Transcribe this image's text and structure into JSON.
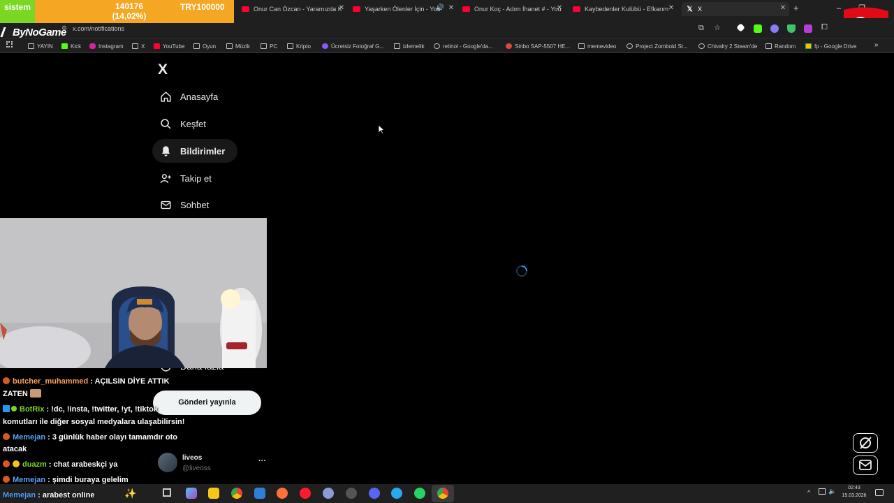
{
  "overlay": {
    "stat_left": "sistem",
    "stat_mid": "140176 (14,02%)",
    "stat_right": "TRY100000",
    "brand": "ByNoGame"
  },
  "browser": {
    "tabs": [
      {
        "title": "Onur Can Özcan - Yaramızda K",
        "icon": "youtube-icon"
      },
      {
        "title": "Yaşarken Ölenler İçin - You",
        "icon": "youtube-icon"
      },
      {
        "title": "Onur Koç - Adım İhanet # - You",
        "icon": "youtube-icon"
      },
      {
        "title": "Kaybedenler Kulübü - Efkarım",
        "icon": "youtube-icon"
      },
      {
        "title": "X",
        "icon": "x-icon"
      }
    ],
    "url": "x.com/notifications",
    "bookmarks": [
      {
        "label": "YAYIN",
        "icon": "folder-icon"
      },
      {
        "label": "Kick",
        "icon": "kick-icon"
      },
      {
        "label": "Instagram",
        "icon": "instagram-icon"
      },
      {
        "label": "X",
        "icon": "x-icon"
      },
      {
        "label": "YouTube",
        "icon": "youtube-icon"
      },
      {
        "label": "Oyun",
        "icon": "folder-icon"
      },
      {
        "label": "Müzik",
        "icon": "folder-icon"
      },
      {
        "label": "PC",
        "icon": "folder-icon"
      },
      {
        "label": "Kripto",
        "icon": "folder-icon"
      },
      {
        "label": "Ücretsiz Fotoğraf G...",
        "icon": "site-icon"
      },
      {
        "label": "izlemelik",
        "icon": "folder-icon"
      },
      {
        "label": "retinol - Google'da...",
        "icon": "google-icon"
      },
      {
        "label": "Sinbo SAP-5507 HE...",
        "icon": "site-icon"
      },
      {
        "label": "memevideo",
        "icon": "folder-icon"
      },
      {
        "label": "Project Zomboid St...",
        "icon": "steam-icon"
      },
      {
        "label": "Chivalry 2 Steam'de",
        "icon": "steam-icon"
      },
      {
        "label": "Random",
        "icon": "folder-icon"
      },
      {
        "label": "fp - Google Drive",
        "icon": "drive-icon"
      }
    ]
  },
  "sidebar": {
    "logo": "X",
    "items": [
      {
        "label": "Anasayfa",
        "icon": "home-icon"
      },
      {
        "label": "Keşfet",
        "icon": "search-icon"
      },
      {
        "label": "Bildirimler",
        "icon": "bell-icon",
        "active": true
      },
      {
        "label": "Takip et",
        "icon": "person-add-icon"
      },
      {
        "label": "Sohbet",
        "icon": "mail-icon"
      },
      {
        "label": "Daha fazla",
        "icon": "more-icon"
      }
    ],
    "post_button": "Gönderi yayınla",
    "account": {
      "name": "liveos",
      "handle": "@liveoss",
      "more": "···"
    }
  },
  "chat": [
    {
      "user": "butcher_muhammed",
      "color": "#f5a05a",
      "text": ": AÇILSIN DİYE ATTIK",
      "line2": "ZATEN"
    },
    {
      "user": "BotRix",
      "color": "#7cd624",
      "text": ": !dc, !insta, !twitter, !yt, !tiktok",
      "line2": "komutları ile diğer sosyal medyalara ulaşabilirsin!"
    },
    {
      "user": "Memejan",
      "color": "#5aa2f5",
      "text": ": 3 günlük haber olayı tamamdır oto",
      "line2": "atacak"
    },
    {
      "user": "duazm",
      "color": "#7cd624",
      "text": ": chat arabeskçi ya"
    },
    {
      "user": "Memejan",
      "color": "#5aa2f5",
      "text": ": şimdi buraya gelelim"
    },
    {
      "user": "Memejan",
      "color": "#5aa2f5",
      "text": ": arabest online"
    }
  ],
  "taskbar": {
    "time": "02:43",
    "date": "15.03.2026"
  },
  "colors": {
    "accent": "#1d9bf0",
    "background": "#000000",
    "text": "#e7e9ea"
  }
}
